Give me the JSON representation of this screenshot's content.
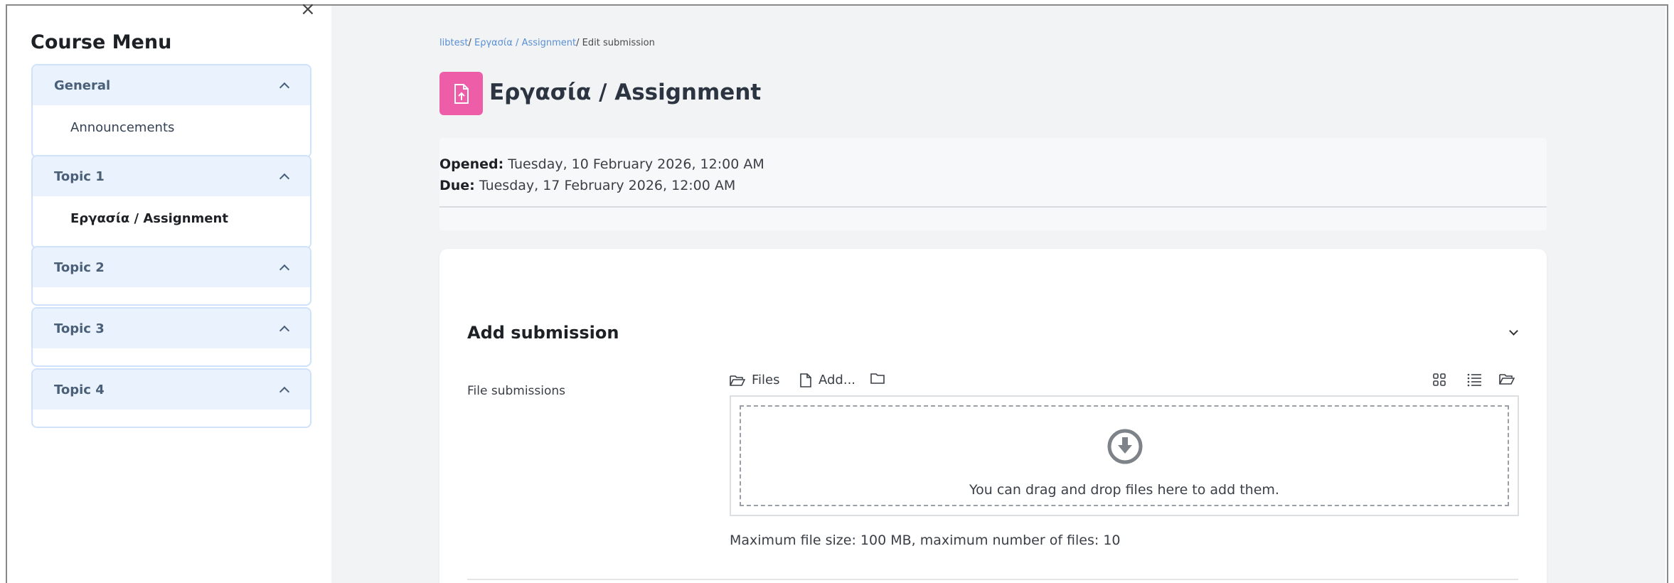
{
  "sidebar": {
    "close_symbol": "×",
    "title": "Course Menu",
    "sections": [
      {
        "title": "General",
        "items": [
          "Announcements"
        ]
      },
      {
        "title": "Topic 1",
        "items": [
          "Εργασία / Assignment"
        ]
      },
      {
        "title": "Topic 2",
        "items": []
      },
      {
        "title": "Topic 3",
        "items": []
      },
      {
        "title": "Topic 4",
        "items": []
      }
    ]
  },
  "breadcrumb": {
    "items": [
      "libtest",
      "Εργασία / Assignment",
      "Edit submission"
    ],
    "separator": "/"
  },
  "page": {
    "title": "Εργασία / Assignment",
    "icon": "assignment-upload-icon",
    "icon_color": "#ee5ea8"
  },
  "dates": {
    "opened_label": "Opened:",
    "opened_value": "Tuesday, 10 February 2026, 12:00 AM",
    "due_label": "Due:",
    "due_value": "Tuesday, 17 February 2026, 12:00 AM"
  },
  "submission": {
    "heading": "Add submission",
    "field_label": "File submissions",
    "toolbar": {
      "files_label": "Files",
      "add_label": "Add...",
      "icons": [
        "folder-open-icon",
        "file-icon",
        "folder-icon",
        "grid-view-icon",
        "list-view-icon",
        "tree-view-icon"
      ]
    },
    "dropzone_text": "You can drag and drop files here to add them.",
    "max_info": "Maximum file size: 100 MB, maximum number of files: 10"
  },
  "colors": {
    "accent": "#ee5ea8",
    "link": "#5a8fd4",
    "section_header_bg": "#e9f2fd",
    "section_border": "#cfe2f9"
  }
}
